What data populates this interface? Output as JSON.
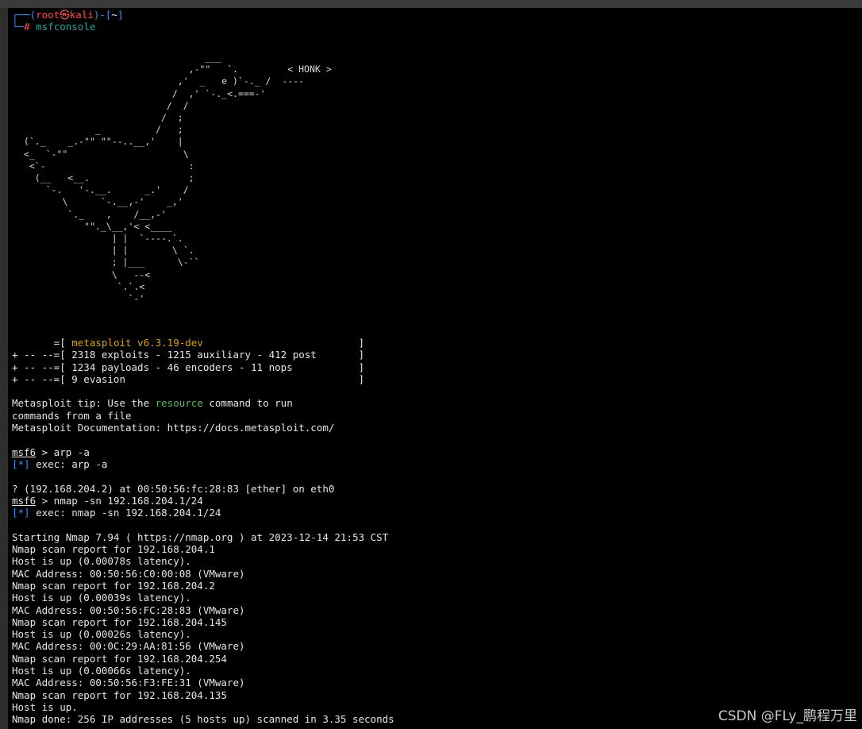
{
  "prompt": {
    "corner_top": "┌──(",
    "user": "root㉿kali",
    "mid": ")-[",
    "path": "~",
    "close": "]",
    "corner_bottom": "└─",
    "hash": "#",
    "command": "msfconsole"
  },
  "banner": {
    "goose": [
      "                                  ___",
      "                               ,-\"\"   `.         < HONK >",
      "                             ,'  _   e )`-._ /  ----",
      "                            /  ,' `-._<.===-'",
      "                           /  /",
      "                          /  ;",
      "              _          /   ;",
      " (`._    _.-\"\" \"\"--..__,'    |",
      " <_  `-\"\"                     \\",
      "  <`-                          :",
      "   (__   <__.                  ;",
      "     `-.   '-.__.      _.'    /",
      "        \\      `-.__,-'    _,'",
      "         `._    ,    /__,-'",
      "            \"\"._\\__,'< <____",
      "                 | |  `----.`.",
      "                 | |        \\ `.",
      "                 ; |___      \\-``",
      "                 \\   --<",
      "                  `.`.<",
      "                    `-'"
    ]
  },
  "header_lines": [
    "       =[ metasploit v6.3.19-dev                          ]",
    "+ -- --=[ 2318 exploits - 1215 auxiliary - 412 post       ]",
    "+ -- --=[ 1234 payloads - 46 encoders - 11 nops           ]",
    "+ -- --=[ 9 evasion                                       ]"
  ],
  "tip": {
    "prefix": "Metasploit tip: Use the ",
    "highlight": "resource",
    "suffix": " command to run",
    "line2": "commands from a file",
    "docs": "Metasploit Documentation: https://docs.metasploit.com/"
  },
  "session": {
    "msf": "msf6",
    "cmd1": " > arp -a",
    "exec1_mark": "[*]",
    "exec1": " exec: arp -a",
    "arp_result": "? (192.168.204.2) at 00:50:56:fc:28:83 [ether] on eth0",
    "cmd2": " > nmap -sn 192.168.204.1/24",
    "exec2_mark": "[*]",
    "exec2": " exec: nmap -sn 192.168.204.1/24"
  },
  "nmap_output": [
    "Starting Nmap 7.94 ( https://nmap.org ) at 2023-12-14 21:53 CST",
    "Nmap scan report for 192.168.204.1",
    "Host is up (0.00078s latency).",
    "MAC Address: 00:50:56:C0:00:08 (VMware)",
    "Nmap scan report for 192.168.204.2",
    "Host is up (0.00039s latency).",
    "MAC Address: 00:50:56:FC:28:83 (VMware)",
    "Nmap scan report for 192.168.204.145",
    "Host is up (0.00026s latency).",
    "MAC Address: 00:0C:29:AA:81:56 (VMware)",
    "Nmap scan report for 192.168.204.254",
    "Host is up (0.00066s latency).",
    "MAC Address: 00:50:56:F3:FE:31 (VMware)",
    "Nmap scan report for 192.168.204.135",
    "Host is up.",
    "Nmap done: 256 IP addresses (5 hosts up) scanned in 3.35 seconds"
  ],
  "watermark": "CSDN @FLy_鹏程万里",
  "colors": {
    "background": "#000000",
    "text": "#e6e6e6",
    "prompt_frame": "#3b8eea",
    "prompt_user": "#ff4d4d",
    "command": "#2aa198",
    "banner_accent": "#d4a017",
    "tip_highlight": "#5cb85c"
  }
}
